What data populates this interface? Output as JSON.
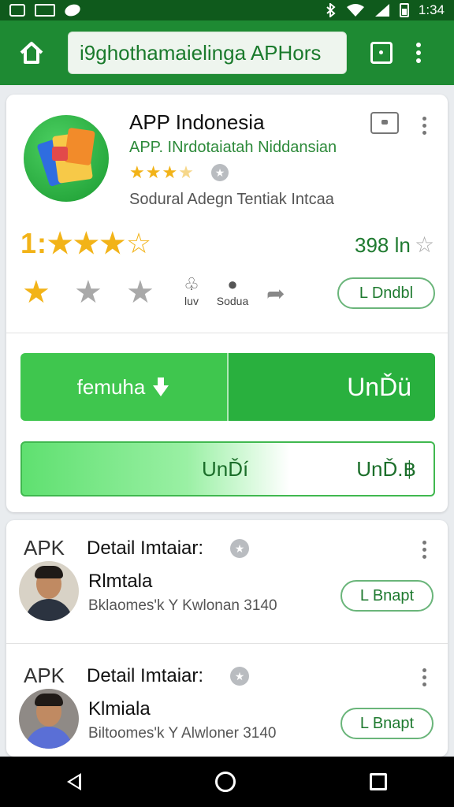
{
  "status_bar": {
    "time": "1:34",
    "icons": [
      "photo-icon",
      "sim-icon",
      "cloud-icon",
      "bluetooth-icon",
      "wifi-icon",
      "signal-icon",
      "battery-icon"
    ]
  },
  "appbar": {
    "url_text": "i9ghothamaielinga APHors",
    "icons": [
      "home-icon",
      "tab-switcher-icon",
      "overflow-menu-icon"
    ]
  },
  "app": {
    "title": "APP Indonesia",
    "subtitle": "APP. INrdotaiatah Niddansian",
    "stars_text": "★★★",
    "stars_dim": "★",
    "description": "Sodural Adegn Tentiak Intcaa",
    "big_rating_num": "1:",
    "big_rating_stars": "★★★",
    "big_rating_outline": "☆",
    "count": "398 ln",
    "count_star": "☆",
    "action_labels": {
      "a": "luv",
      "b": "Sodua"
    },
    "outline_button": "L Dndbl",
    "download_left": "femuha",
    "download_right": "UnĎü",
    "secondary_a": "UnĎí",
    "secondary_b": "UnĎ.฿"
  },
  "list": [
    {
      "tag": "APK",
      "title": "Detail Imtaiar:",
      "name": "Rlmtala",
      "meta": "Bklaomes'k Y Kwlonan 3140",
      "button": "L Bnapt"
    },
    {
      "tag": "APK",
      "title": "Detail Imtaiar:",
      "name": "Klmiala",
      "meta": "Biltoomes'k Y Alwloner 3140",
      "button": "L Bnapt"
    }
  ],
  "colors": {
    "appbar": "#1e8a33",
    "status": "#0f5a1c",
    "accent": "#29b03e",
    "star": "#f2b318"
  }
}
